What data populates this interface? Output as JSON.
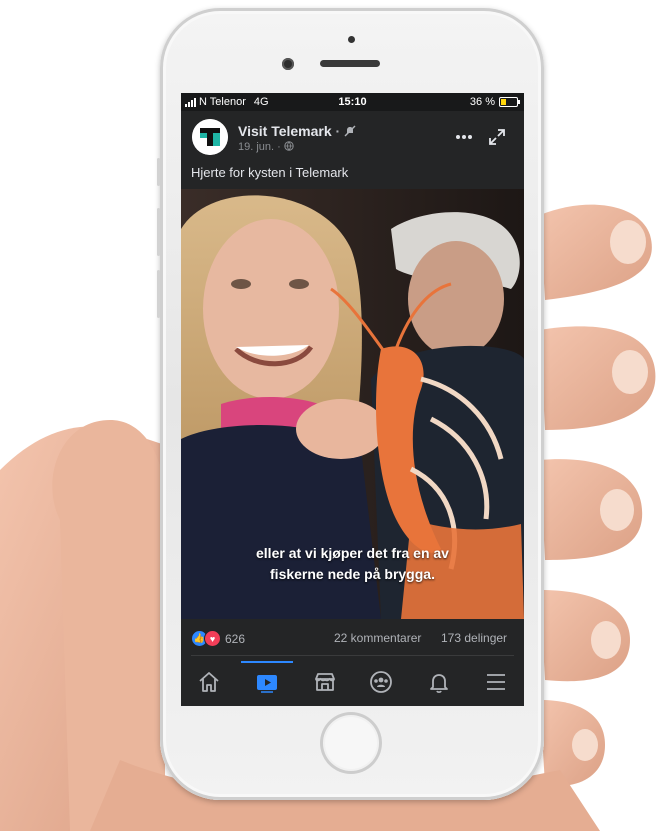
{
  "status_bar": {
    "carrier": "N Telenor",
    "network": "4G",
    "time": "15:10",
    "battery": "36 %"
  },
  "post": {
    "page_name": "Visit Telemark",
    "separator": "·",
    "date": "19. jun.",
    "date_separator": "·",
    "caption": "Hjerte for kysten i Telemark",
    "subtitle_lines": [
      "eller at vi kjøper det fra en av",
      "fiskerne nede på brygga."
    ],
    "reaction_count": "626",
    "comments": "22 kommentarer",
    "shares": "173 delinger"
  },
  "tabbar": {
    "items": [
      {
        "icon": "home-icon"
      },
      {
        "icon": "video-icon",
        "active": true
      },
      {
        "icon": "marketplace-icon"
      },
      {
        "icon": "groups-icon"
      },
      {
        "icon": "bell-icon"
      },
      {
        "icon": "menu-icon"
      }
    ]
  },
  "colors": {
    "accent": "#2d88ff",
    "background": "#242526",
    "love": "#f33e58",
    "battery": "#ffd60a"
  }
}
